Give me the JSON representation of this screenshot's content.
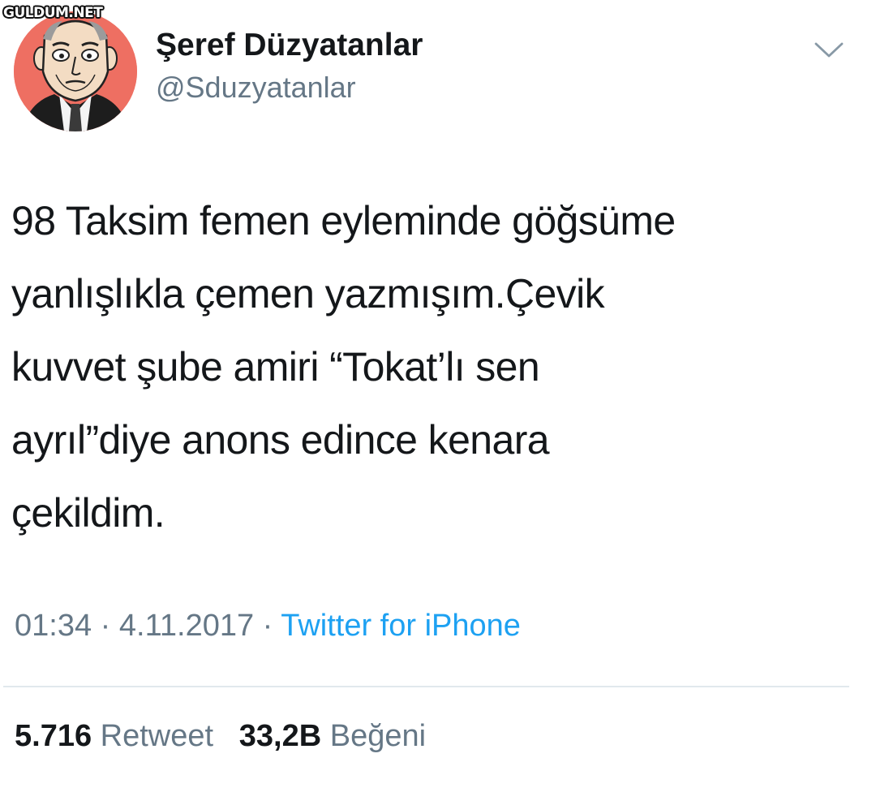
{
  "watermark": "GULDUM.NET",
  "tweet": {
    "author": {
      "display_name": "Şeref Düzyatanlar",
      "handle": "@Sduzyatanlar",
      "avatar_icon": "cartoon-portrait-avatar"
    },
    "menu_icon": "chevron-down-icon",
    "text_lines": [
      "98 Taksim femen eyleminde göğsüme",
      "yanlışlıkla çemen yazmışım.Çevik",
      "kuvvet şube amiri “Tokat’lı sen",
      "ayrıl”diye anons edince kenara",
      "çekildim."
    ],
    "time": "01:34",
    "separator": "·",
    "date": "4.11.2017",
    "source": "Twitter for iPhone",
    "retweets": {
      "count": "5.716",
      "label": "Retweet"
    },
    "likes": {
      "count": "33,2B",
      "label": "Beğeni"
    }
  },
  "colors": {
    "text_primary": "#14171a",
    "text_secondary": "#657786",
    "link": "#1da1f2",
    "avatar_bg": "#ee6f62",
    "divider": "#e1e8ed"
  }
}
